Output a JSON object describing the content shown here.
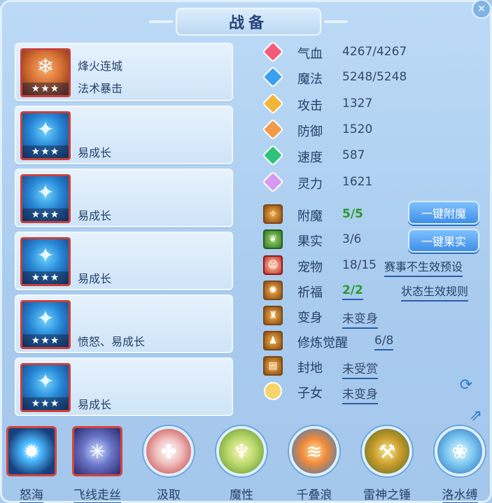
{
  "window": {
    "title": "战备"
  },
  "cards": [
    {
      "line1": "烽火连城",
      "line2": "法术暴击",
      "stars": "★★★",
      "icon": "popsicle-icon"
    },
    {
      "line1": "",
      "line2": "易成长",
      "stars": "★★★",
      "icon": "water-spirit-icon"
    },
    {
      "line1": "",
      "line2": "易成长",
      "stars": "★★★",
      "icon": "water-spirit-icon"
    },
    {
      "line1": "",
      "line2": "易成长",
      "stars": "★★★",
      "icon": "water-spirit-icon"
    },
    {
      "line1": "",
      "line2": "愤怒、易成长",
      "stars": "★★★",
      "icon": "water-spirit-icon"
    },
    {
      "line1": "",
      "line2": "易成长",
      "stars": "★★★",
      "icon": "water-spirit-icon"
    }
  ],
  "stats": [
    {
      "label": "气血",
      "value": "4267/4267",
      "color": "#f25c7a",
      "icon": "heart-icon"
    },
    {
      "label": "魔法",
      "value": "5248/5248",
      "color": "#3aa0f0",
      "icon": "mana-icon"
    },
    {
      "label": "攻击",
      "value": "1327",
      "color": "#f3b43a",
      "icon": "sword-icon"
    },
    {
      "label": "防御",
      "value": "1520",
      "color": "#f39a4a",
      "icon": "shield-icon"
    },
    {
      "label": "速度",
      "value": "587",
      "color": "#2fc27a",
      "icon": "speed-icon"
    },
    {
      "label": "灵力",
      "value": "1621",
      "color": "#d59af0",
      "icon": "spirit-icon"
    }
  ],
  "extras": [
    {
      "label": "附魔",
      "value": "5/5",
      "icon": "enchant-icon"
    },
    {
      "label": "果实",
      "value": "3/6",
      "icon": "fruit-icon"
    },
    {
      "label": "宠物",
      "value": "18/15",
      "icon": "pet-avatar-icon"
    },
    {
      "label": "祈福",
      "value": "2/2",
      "icon": "blessing-icon"
    },
    {
      "label": "变身",
      "value": "未变身",
      "icon": "transform-icon"
    },
    {
      "label": "修炼觉醒",
      "value": "6/8",
      "icon": "cultivate-icon"
    },
    {
      "label": "封地",
      "value": "未受赏",
      "icon": "fief-icon"
    },
    {
      "label": "子女",
      "value": "未变身",
      "icon": "child-icon"
    }
  ],
  "buttons": {
    "enchant_all": "一键附魔",
    "fruit_all": "一键果实"
  },
  "links": {
    "match_preset": "赛事不生效预设",
    "status_rules": "状态生效规则"
  },
  "skills": [
    {
      "name": "怒海",
      "icon": "orb-icon"
    },
    {
      "name": "飞线走丝",
      "icon": "web-icon"
    },
    {
      "name": "汲取",
      "icon": "absorb-icon"
    },
    {
      "name": "魔性",
      "icon": "demon-icon"
    },
    {
      "name": "千叠浪",
      "icon": "wave-icon"
    },
    {
      "name": "雷神之锤",
      "icon": "hammer-icon"
    },
    {
      "name": "洛水缚",
      "icon": "bind-icon"
    }
  ]
}
